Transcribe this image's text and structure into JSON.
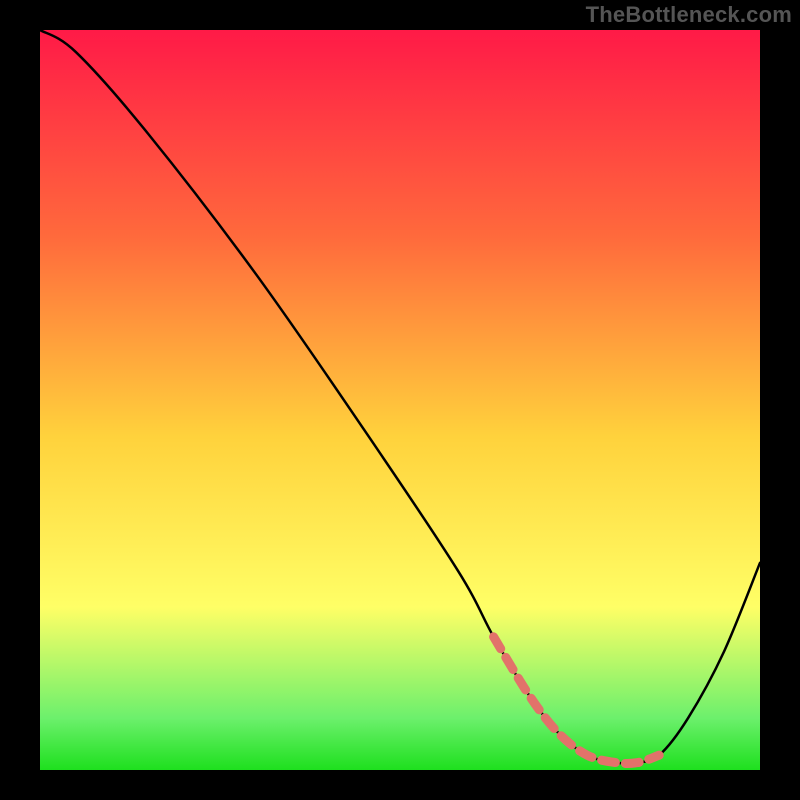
{
  "watermark": "TheBottleneck.com",
  "chart_data": {
    "type": "line",
    "title": "",
    "xlabel": "",
    "ylabel": "",
    "xlim": [
      0,
      100
    ],
    "ylim": [
      0,
      100
    ],
    "background_gradient": {
      "stops": [
        "#ff1a47",
        "#ff6a3c",
        "#ffd23c",
        "#ffff66",
        "#6cf06c",
        "#1ee01e"
      ]
    },
    "curve": {
      "name": "bottleneck curve",
      "x": [
        0,
        5,
        15,
        30,
        45,
        58,
        63,
        68,
        72,
        76,
        80,
        83,
        86,
        90,
        95,
        100
      ],
      "y": [
        100,
        97,
        86,
        67,
        46,
        27,
        18,
        10,
        5,
        2,
        1,
        1,
        2,
        7,
        16,
        28
      ]
    },
    "highlight_segment": {
      "color": "#e2726a",
      "x": [
        63,
        68,
        72,
        76,
        80,
        83,
        86
      ],
      "y": [
        18,
        10,
        5,
        2,
        1,
        1,
        2
      ]
    }
  }
}
